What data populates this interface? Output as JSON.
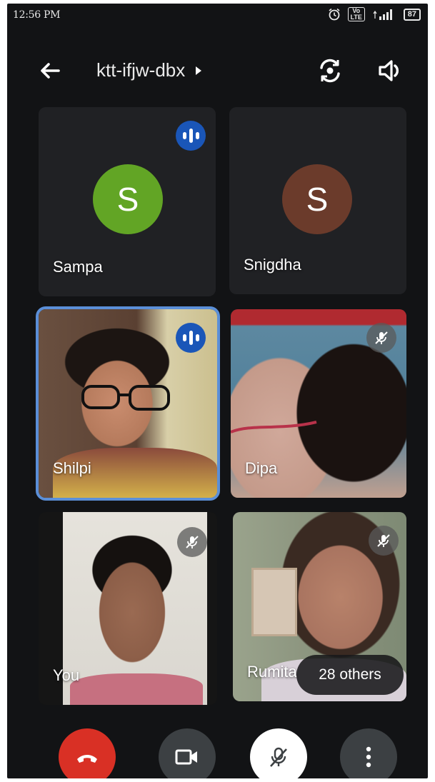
{
  "status_bar": {
    "time": "12:56 PM",
    "battery": "87",
    "network": "Vo LTE"
  },
  "header": {
    "meeting_code": "ktt-ifjw-dbx"
  },
  "participants": [
    {
      "name": "Sampa",
      "initial": "S",
      "avatar_color": "#62a525",
      "speaking": true
    },
    {
      "name": "Snigdha",
      "initial": "S",
      "avatar_color": "#6b3b2b",
      "speaking": false
    },
    {
      "name": "Shilpi",
      "video": true,
      "speaking": true,
      "pinned_highlight": true
    },
    {
      "name": "Dipa",
      "video": true,
      "muted": true
    },
    {
      "name": "You",
      "video": true,
      "muted": true
    },
    {
      "name": "Rumita",
      "video": true,
      "muted": true
    }
  ],
  "others_chip": "28 others",
  "controls": {
    "end_call_color": "#d93025",
    "items": [
      "end-call",
      "camera",
      "microphone-muted",
      "more-options"
    ]
  },
  "colors": {
    "background": "#121315",
    "tile": "#202124",
    "accent": "#1a56b8",
    "highlight": "#5b8fd8"
  }
}
